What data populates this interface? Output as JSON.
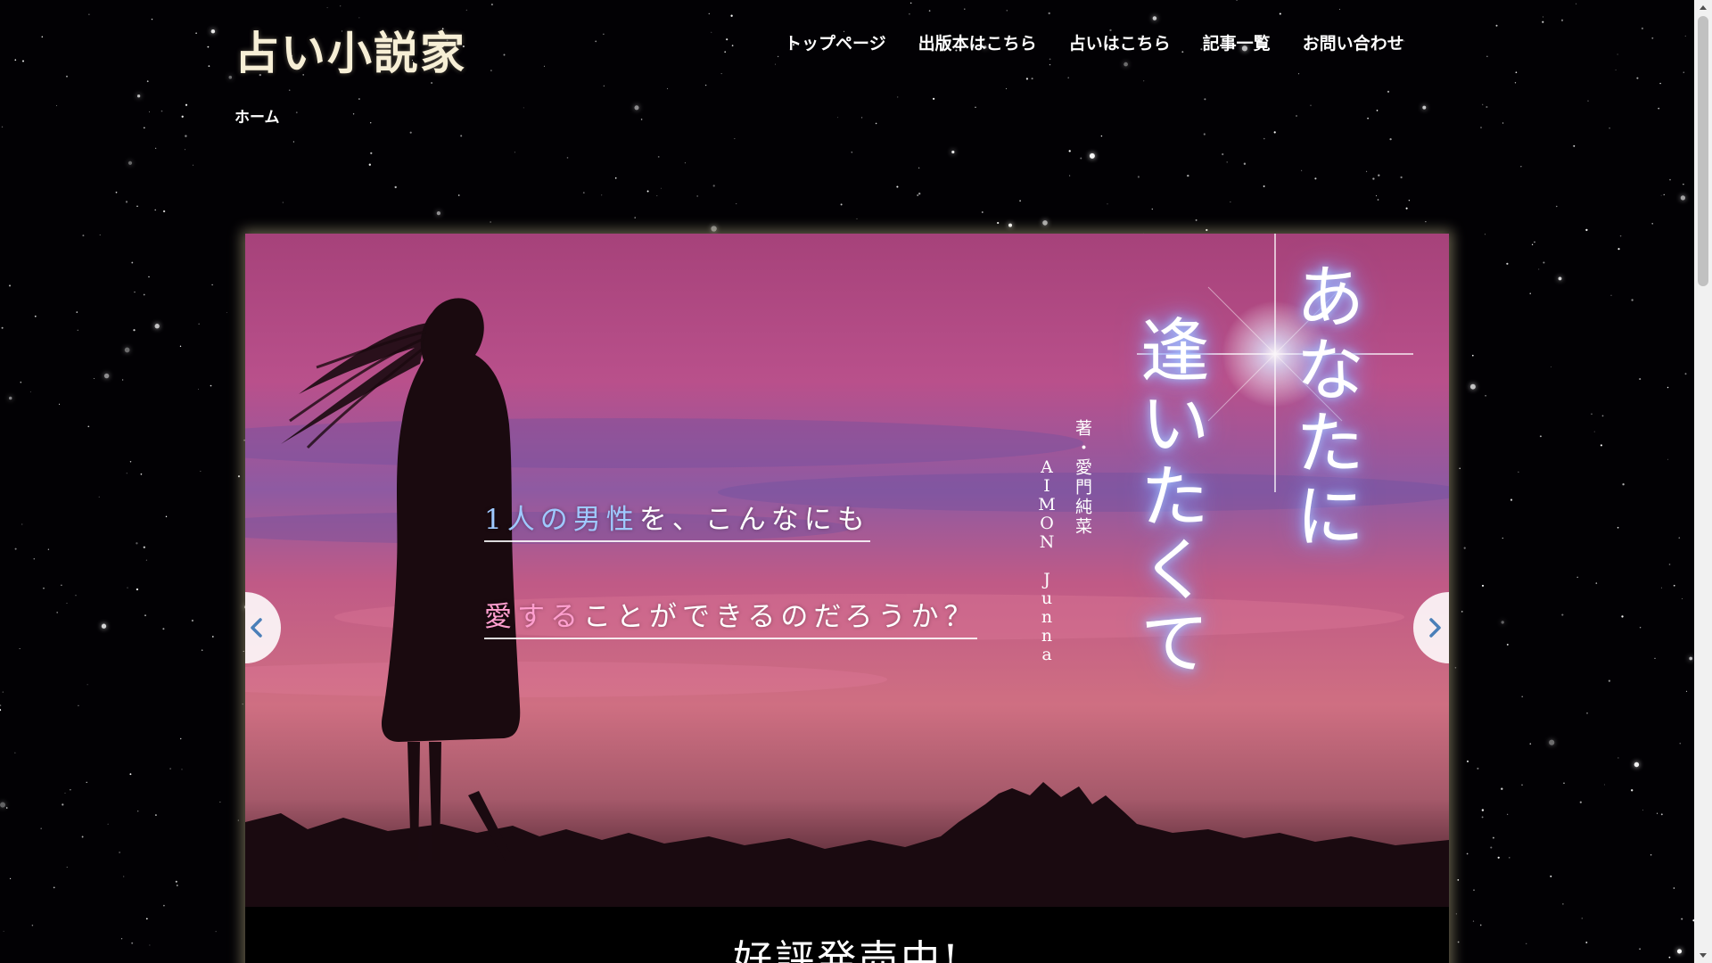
{
  "header": {
    "logo": "占い小説家",
    "nav": [
      {
        "label": "トップページ"
      },
      {
        "label": "出版本はこちら"
      },
      {
        "label": "占いはこちら"
      },
      {
        "label": "記事一覧"
      },
      {
        "label": "お問い合わせ"
      }
    ]
  },
  "breadcrumb": {
    "home": "ホーム"
  },
  "slider": {
    "catch_line_1": {
      "highlight": "1人の男性",
      "rest": "を、こんなにも"
    },
    "catch_line_2": {
      "highlight": "愛する",
      "rest": "ことができるのだろうか？"
    },
    "book_title_1": "あなたに",
    "book_title_2": "逢いたくて",
    "author_jp": "著・愛門純菜",
    "author_en": "AIMON Junna",
    "caption": "好評発売中!"
  },
  "colors": {
    "logo": "#f7efd6",
    "highlight_blue": "#9fc9ff",
    "highlight_pink": "#ff9fcf",
    "sky_top": "#b0477f",
    "sky_bottom": "#2a1018"
  },
  "icons": {
    "prev": "chevron-left-icon",
    "next": "chevron-right-icon"
  }
}
